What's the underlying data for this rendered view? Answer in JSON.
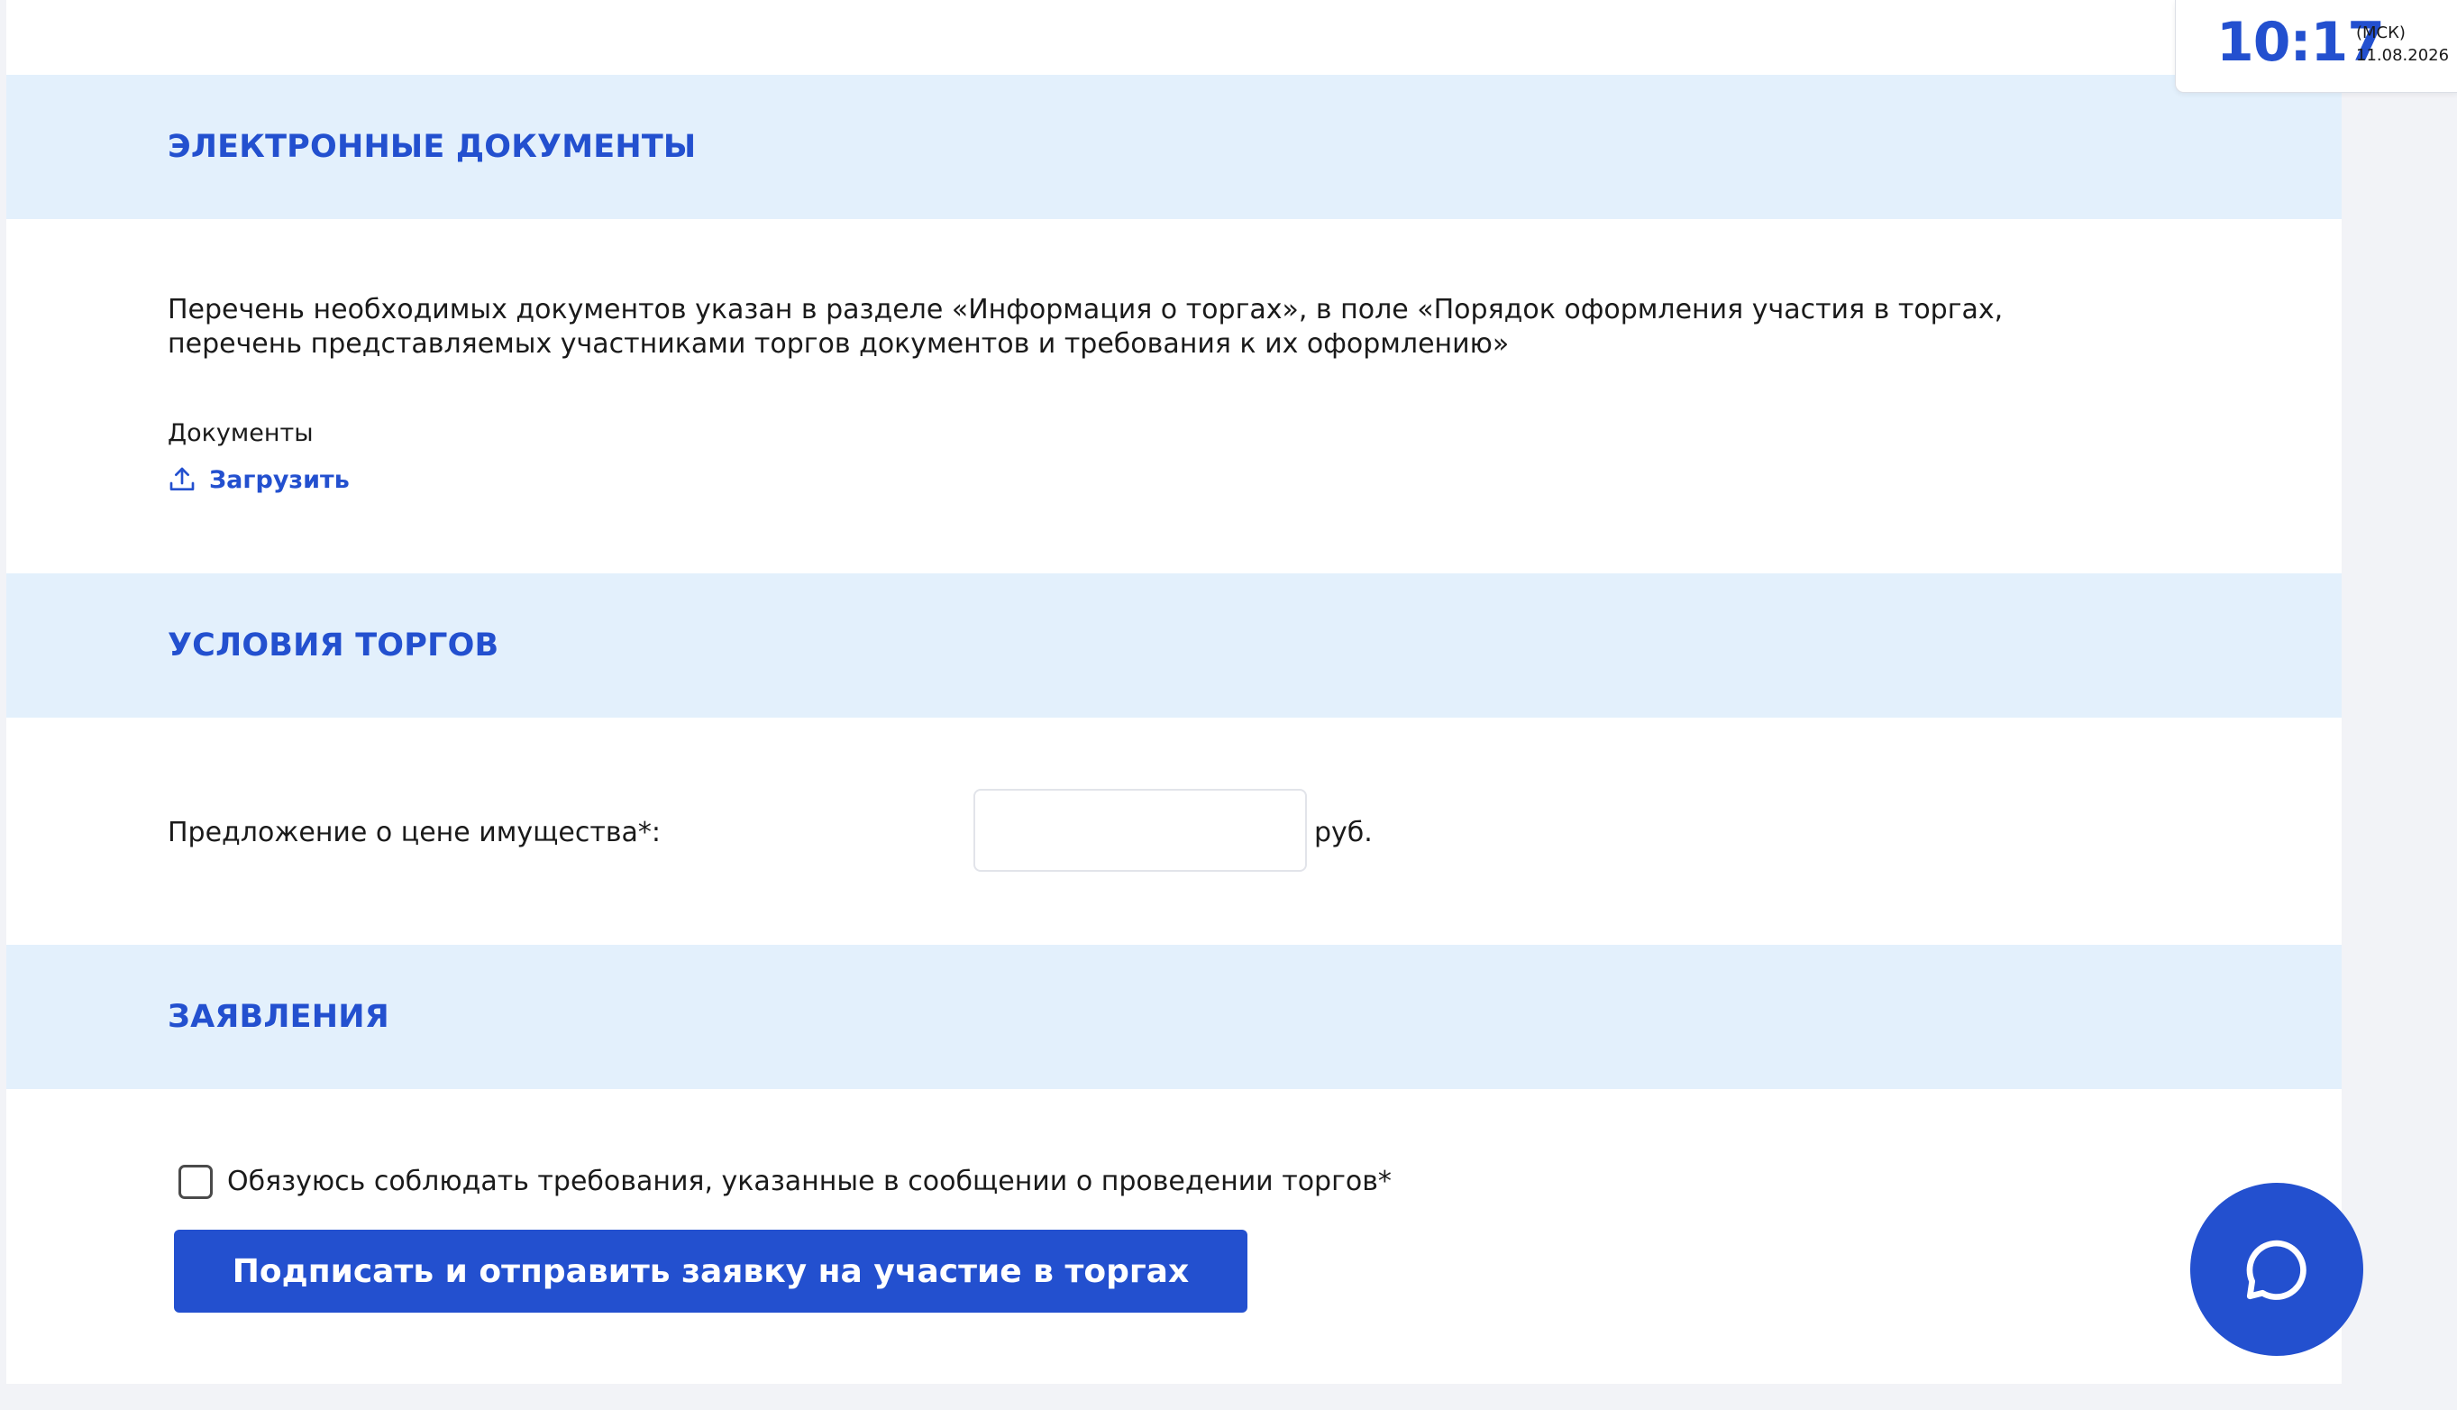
{
  "clock": {
    "time": "10:17",
    "timezone": "(МСК)",
    "date": "11.08.2026"
  },
  "sections": {
    "documents": {
      "title": "ЭЛЕКТРОННЫЕ ДОКУМЕНТЫ",
      "description": "Перечень необходимых документов указан в разделе «Информация о торгах», в поле «Порядок оформления участия в торгах, перечень представляемых участниками торгов документов и требования к их оформлению»",
      "documents_label": "Документы",
      "upload_label": "Загрузить",
      "upload_icon": "upload-icon"
    },
    "terms": {
      "title": "УСЛОВИЯ ТОРГОВ",
      "price_label": "Предложение о цене имущества*:",
      "price_value": "",
      "price_unit": "руб."
    },
    "statements": {
      "title": "ЗАЯВЛЕНИЯ",
      "agreement_checked": false,
      "agreement_text": "Обязуюсь соблюдать требования, указанные в сообщении о проведении торгов*",
      "submit_label": "Подписать и отправить заявку на участие в торгах"
    }
  },
  "chat": {
    "icon": "chat-bubble-icon"
  },
  "colors": {
    "accent": "#2350cf",
    "section_header_bg": "#e3f0fc",
    "page_bg": "#f2f3f7"
  }
}
